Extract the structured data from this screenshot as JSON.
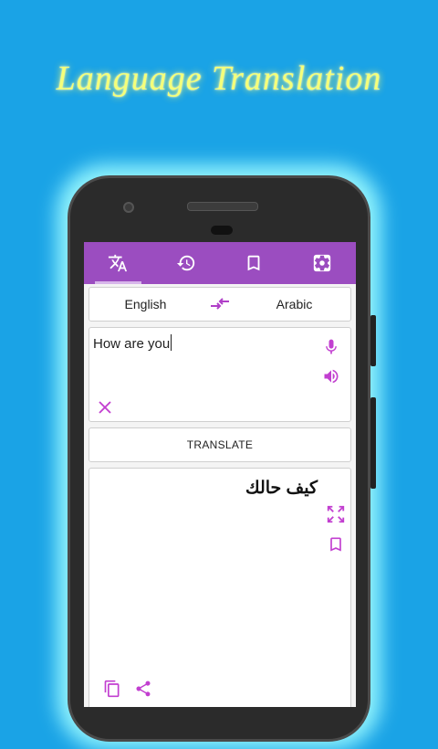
{
  "promo": {
    "title": "Language Translation"
  },
  "appbar": {
    "tabs": [
      {
        "name": "translate",
        "icon": "translate-icon",
        "active": true
      },
      {
        "name": "history",
        "icon": "history-icon",
        "active": false
      },
      {
        "name": "bookmarks",
        "icon": "bookmark-icon",
        "active": false
      },
      {
        "name": "settings",
        "icon": "settings-icon",
        "active": false
      }
    ],
    "color": "#9b4dc0"
  },
  "languages": {
    "source": "English",
    "target": "Arabic",
    "swap_icon": "swap-icon"
  },
  "input": {
    "text": "How are you",
    "mic_icon": "mic-icon",
    "speaker_icon": "speaker-icon",
    "clear_icon": "close-icon"
  },
  "translate_button": {
    "label": "TRANSLATE"
  },
  "output": {
    "text": "كيف حالك",
    "expand_icon": "fullscreen-icon",
    "bookmark_icon": "bookmark-icon",
    "copy_icon": "copy-icon",
    "share_icon": "share-icon"
  },
  "accent": "#c23fd0"
}
